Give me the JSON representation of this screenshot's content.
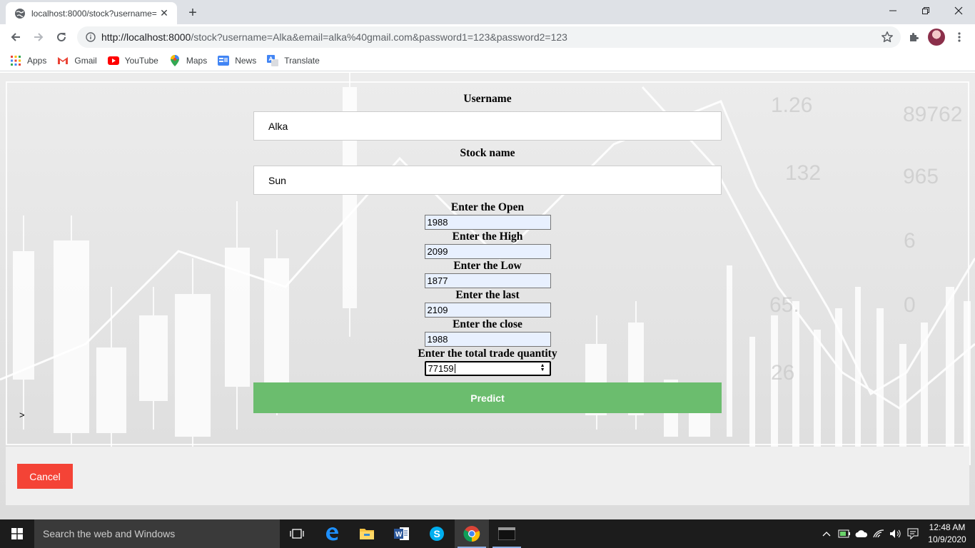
{
  "browser": {
    "tab_title": "localhost:8000/stock?username=",
    "url_host": "http://localhost:8000",
    "url_rest": "/stock?username=Alka&email=alka%40gmail.com&password1=123&password2=123",
    "bookmarks": [
      {
        "label": "Apps",
        "icon": "apps-grid-icon"
      },
      {
        "label": "Gmail",
        "icon": "gmail-icon"
      },
      {
        "label": "YouTube",
        "icon": "youtube-icon"
      },
      {
        "label": "Maps",
        "icon": "maps-icon"
      },
      {
        "label": "News",
        "icon": "news-icon"
      },
      {
        "label": "Translate",
        "icon": "translate-icon"
      }
    ]
  },
  "form": {
    "username_label": "Username",
    "username_value": "Alka",
    "stock_label": "Stock name",
    "stock_value": "Sun",
    "fields": [
      {
        "label": "Enter the Open",
        "value": "1988"
      },
      {
        "label": "Enter the High",
        "value": "2099"
      },
      {
        "label": "Enter the Low",
        "value": "1877"
      },
      {
        "label": "Enter the last",
        "value": "2109"
      },
      {
        "label": "Enter the close",
        "value": "1988"
      },
      {
        "label": "Enter the total trade quantity",
        "value": "77159"
      }
    ],
    "predict_label": "Predict",
    "stray_text": ">",
    "cancel_label": "Cancel"
  },
  "background_digits": [
    "1.26",
    "89762",
    "132",
    "965",
    "6",
    "65.",
    "0",
    "26"
  ],
  "taskbar": {
    "search_placeholder": "Search the web and Windows",
    "time": "12:48 AM",
    "date": "10/9/2020"
  },
  "colors": {
    "predict_bg": "#6bbd6e",
    "cancel_bg": "#f44336",
    "input_autofill_bg": "#e8f0fe",
    "taskbar_bg": "#1c1c1c"
  }
}
